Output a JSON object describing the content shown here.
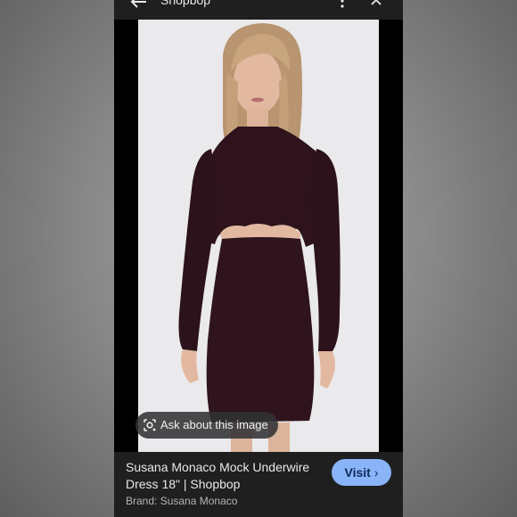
{
  "topbar": {
    "title": "Shopbop",
    "icons": [
      "arrow-back-icon",
      "more-vertical-icon",
      "close-icon"
    ]
  },
  "image": {
    "ask_label": "Ask about this image",
    "ask_icon": "google-lens-icon"
  },
  "result": {
    "title": "Susana Monaco Mock Underwire Dress 18\" | Shopbop",
    "brand": "Brand: Susana Monaco",
    "visit_label": "Visit",
    "visit_icon": "chevron-right-icon"
  },
  "colors": {
    "accent": "#8ab4f8",
    "dress": "#2e131d",
    "panel": "#1f1f1f"
  }
}
